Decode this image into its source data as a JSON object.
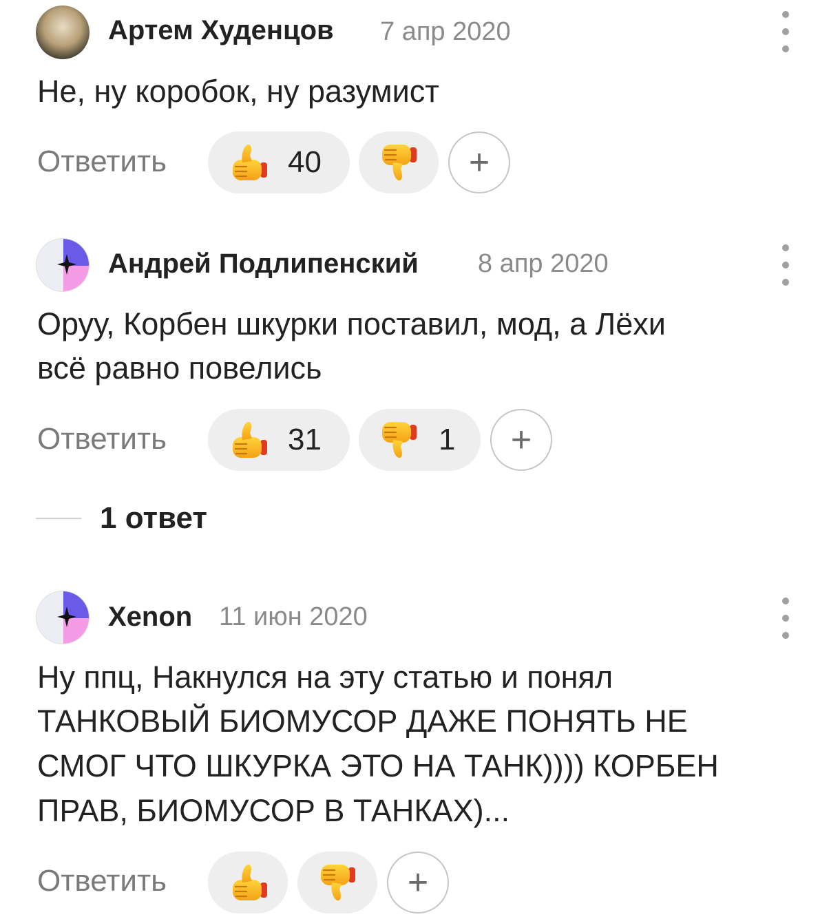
{
  "comments": [
    {
      "author": "Артем Худенцов",
      "date": "7 апр 2020",
      "text": "Не, ну коробок, ну разумист",
      "reply_label": "Ответить",
      "likes": "40",
      "dislikes": "",
      "plus": "+"
    },
    {
      "author": "Андрей Подлипенский",
      "date": "8 апр 2020",
      "text_lines": [
        "Оруу, Корбен шкурки поставил, мод, а Лёхи",
        "всё равно повелись"
      ],
      "reply_label": "Ответить",
      "likes": "31",
      "dislikes": "1",
      "plus": "+",
      "replies_label": "1 ответ"
    },
    {
      "author": "Xenon",
      "date": "11 июн 2020",
      "text_lines": [
        "Ну ппц, Накнулся на эту статью и понял",
        "ТАНКОВЫЙ БИОМУСОР ДАЖЕ ПОНЯТЬ НЕ",
        "СМОГ ЧТО ШКУРКА ЭТО НА ТАНК)))) КОРБЕН",
        "ПРАВ, БИОМУСОР В ТАНКАХ)..."
      ],
      "reply_label": "Ответить",
      "likes": "",
      "dislikes": "",
      "plus": "+"
    }
  ],
  "icons": {
    "like": "thumbs-up-icon",
    "dislike": "thumbs-down-icon",
    "menu": "kebab-menu-icon"
  },
  "colors": {
    "pill_bg": "#eeeeee",
    "date": "#8a8a8a",
    "reply": "#7a7a7a",
    "emoji_yellow": "#fbbd24",
    "emoji_red": "#e33b1f"
  }
}
